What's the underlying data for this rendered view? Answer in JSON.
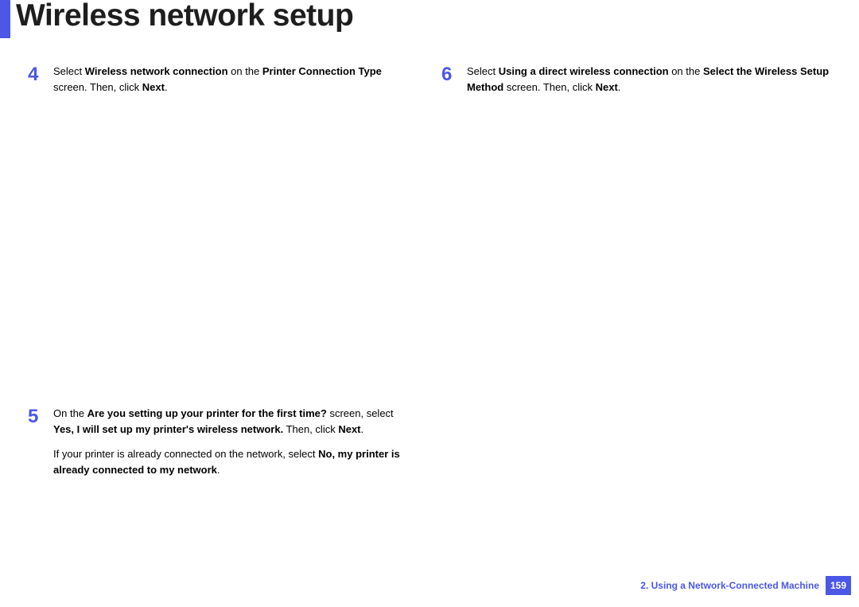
{
  "title": "Wireless network setup",
  "steps": {
    "s4": {
      "number": "4",
      "pre1": "Select ",
      "b1": "Wireless network connection",
      "mid1": " on the ",
      "b2": "Printer Connection Type",
      "post1": " screen. Then, click ",
      "b3": "Next",
      "end1": "."
    },
    "s5": {
      "number": "5",
      "p1_pre": "On the ",
      "p1_b1": "Are you setting up your printer for the first time?",
      "p1_mid": " screen, select ",
      "p1_b2": "Yes, I will set up my printer's wireless network.",
      "p1_post": " Then, click ",
      "p1_b3": "Next",
      "p1_end": ".",
      "p2_pre": "If your printer is already connected on the network, select ",
      "p2_b1": "No, my printer is already connected to my network",
      "p2_end": "."
    },
    "s6": {
      "number": "6",
      "pre1": "Select ",
      "b1": "Using a direct wireless connection",
      "mid1": " on the ",
      "b2": "Select the Wireless Setup Method",
      "post1": " screen. Then, click ",
      "b3": "Next",
      "end1": "."
    }
  },
  "footer": {
    "chapter": "2.  Using a Network-Connected Machine",
    "page": "159"
  }
}
